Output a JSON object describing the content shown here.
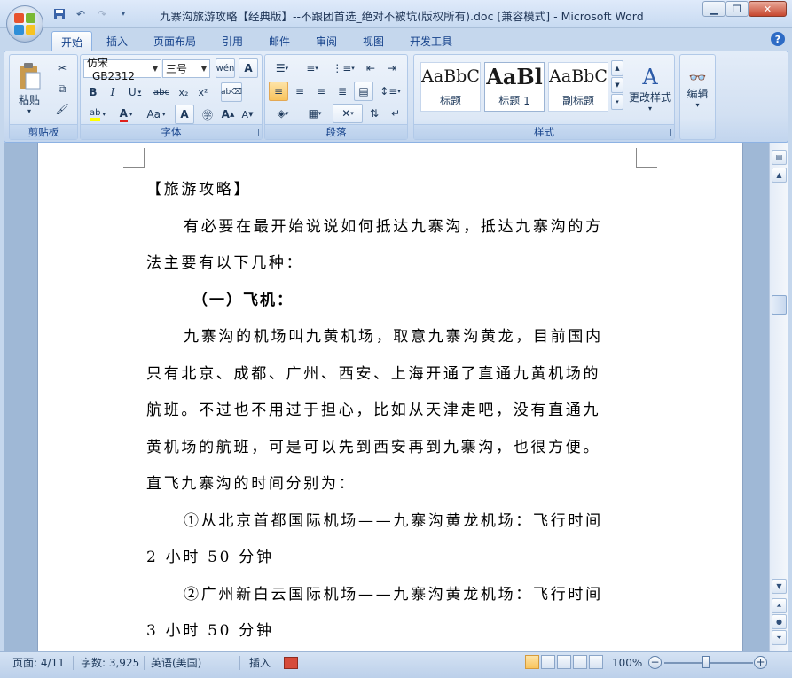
{
  "window": {
    "title": "九寨沟旅游攻略【经典版】--不跟团首选_绝对不被坑(版权所有).doc [兼容模式] - Microsoft Word",
    "minimize_icon": "minimize-icon",
    "maximize_icon": "maximize-icon",
    "close_icon": "close-icon"
  },
  "tabs": [
    "开始",
    "插入",
    "页面布局",
    "引用",
    "邮件",
    "审阅",
    "视图",
    "开发工具"
  ],
  "active_tab": "开始",
  "ribbon": {
    "clipboard": {
      "label": "剪贴板",
      "paste": "粘贴"
    },
    "font": {
      "label": "字体",
      "font_name": "仿宋_GB2312",
      "font_size": "三号",
      "bold": "B",
      "italic": "I",
      "underline": "U",
      "strike": "abc",
      "subscript": "x₂",
      "superscript": "x²",
      "font_color": "A",
      "change_case": "Aa",
      "grow": "A",
      "shrink": "A",
      "phonetic": "wén",
      "char_border": "A",
      "highlight": "ab"
    },
    "paragraph": {
      "label": "段落"
    },
    "styles": {
      "label": "样式",
      "items": [
        {
          "sample": "AaBbC",
          "name": "标题"
        },
        {
          "sample": "AaBl",
          "name": "标题 1"
        },
        {
          "sample": "AaBbC",
          "name": "副标题"
        }
      ],
      "change_styles": "更改样式"
    },
    "editing": {
      "label": "编辑"
    }
  },
  "document": {
    "paragraphs": [
      {
        "text": "【旅游攻略】",
        "style": "plain"
      },
      {
        "text": "有必要在最开始说说如何抵达九寨沟，抵达九寨沟的方",
        "style": "indent"
      },
      {
        "text": "法主要有以下几种：",
        "style": "plain"
      },
      {
        "text": "（一）飞机：",
        "style": "bold"
      },
      {
        "text": "九寨沟的机场叫九黄机场，取意九寨沟黄龙，目前国内",
        "style": "indent"
      },
      {
        "text": "只有北京、成都、广州、西安、上海开通了直通九黄机场的",
        "style": "plain"
      },
      {
        "text": "航班。不过也不用过于担心，比如从天津走吧，没有直通九",
        "style": "plain"
      },
      {
        "text": "黄机场的航班，可是可以先到西安再到九寨沟，也很方便。",
        "style": "plain"
      },
      {
        "text": "直飞九寨沟的时间分别为：",
        "style": "plain"
      },
      {
        "text": "①从北京首都国际机场——九寨沟黄龙机场：飞行时间",
        "style": "indent"
      },
      {
        "text": "2 小时 50 分钟",
        "style": "plain"
      },
      {
        "text": "②广州新白云国际机场——九寨沟黄龙机场：飞行时间",
        "style": "indent"
      },
      {
        "text": "3 小时 50 分钟",
        "style": "plain"
      }
    ]
  },
  "statusbar": {
    "page": "页面: 4/11",
    "words": "字数: 3,925",
    "language": "英语(美国)",
    "mode": "插入",
    "zoom": "100%",
    "zoom_level": 100
  }
}
